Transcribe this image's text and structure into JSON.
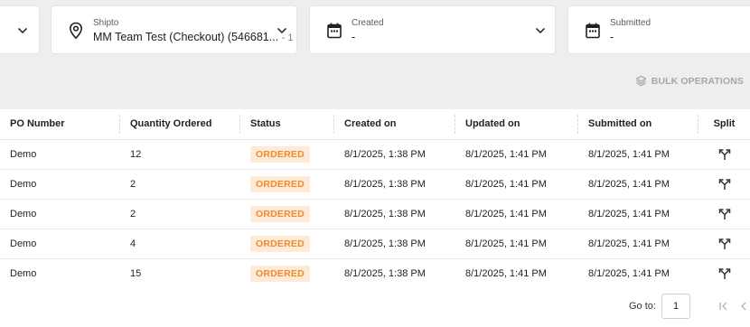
{
  "filters": [
    {
      "label": "",
      "value": "",
      "suffix": "",
      "icon": "chevron-down-icon"
    },
    {
      "label": "Shipto",
      "value": "MM Team Test (Checkout) (546681...",
      "suffix": "- 1",
      "icon": "map-pin-icon"
    },
    {
      "label": "Created",
      "value": "-",
      "suffix": "",
      "icon": "calendar-icon"
    },
    {
      "label": "Submitted",
      "value": "-",
      "suffix": "",
      "icon": "calendar-icon"
    }
  ],
  "bulk_operations": {
    "label": "BULK OPERATIONS",
    "icon": "layers-icon"
  },
  "table": {
    "columns": [
      "PO Number",
      "Quantity Ordered",
      "Status",
      "Created on",
      "Updated on",
      "Submitted on",
      "Split"
    ],
    "rows": [
      {
        "po": "Demo",
        "qty": "12",
        "status": "ORDERED",
        "created": "8/1/2025, 1:38 PM",
        "updated": "8/1/2025, 1:41 PM",
        "submitted": "8/1/2025, 1:41 PM"
      },
      {
        "po": "Demo",
        "qty": "2",
        "status": "ORDERED",
        "created": "8/1/2025, 1:38 PM",
        "updated": "8/1/2025, 1:41 PM",
        "submitted": "8/1/2025, 1:41 PM"
      },
      {
        "po": "Demo",
        "qty": "2",
        "status": "ORDERED",
        "created": "8/1/2025, 1:38 PM",
        "updated": "8/1/2025, 1:41 PM",
        "submitted": "8/1/2025, 1:41 PM"
      },
      {
        "po": "Demo",
        "qty": "4",
        "status": "ORDERED",
        "created": "8/1/2025, 1:38 PM",
        "updated": "8/1/2025, 1:41 PM",
        "submitted": "8/1/2025, 1:41 PM"
      },
      {
        "po": "Demo",
        "qty": "15",
        "status": "ORDERED",
        "created": "8/1/2025, 1:38 PM",
        "updated": "8/1/2025, 1:41 PM",
        "submitted": "8/1/2025, 1:41 PM"
      }
    ]
  },
  "pagination": {
    "goto_label": "Go to:",
    "page": "1"
  },
  "colors": {
    "status_bg": "#fdebd8",
    "status_text": "#f08a2c",
    "page_bg": "#eeeeee"
  }
}
